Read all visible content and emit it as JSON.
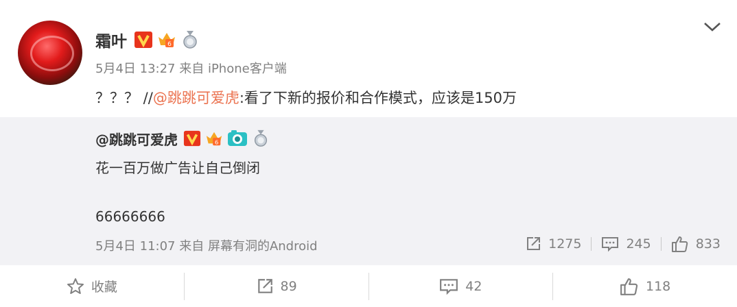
{
  "post": {
    "author": "霜叶",
    "time": "5月4日 13:27",
    "source": "来自 iPhone客户端",
    "text_prefix": "？？？ //",
    "mention": "@跳跳可爱虎",
    "text_suffix": ":看了下新的报价和合作模式，应该是150万"
  },
  "repost": {
    "author": "@跳跳可爱虎",
    "line1": "花一百万做广告让自己倒闭",
    "line2": "66666666",
    "time": "5月4日 11:07",
    "source": "来自 屏幕有洞的Android",
    "reposts": "1275",
    "comments": "245",
    "likes": "833"
  },
  "actions": {
    "favorite": "收藏",
    "reposts": "89",
    "comments": "42",
    "likes": "118"
  },
  "colors": {
    "mention": "#eb7350",
    "repost_bg": "#f2f2f5",
    "verified": "#e8341c"
  }
}
